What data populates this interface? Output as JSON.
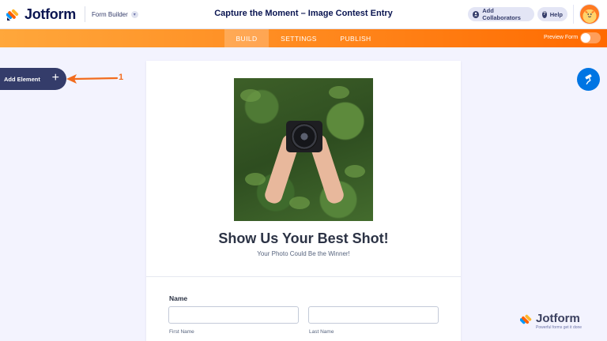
{
  "header": {
    "brand": "Jotform",
    "builder_label": "Form Builder",
    "form_title": "Capture the Moment – Image Contest Entry",
    "add_collaborators": "Add Collaborators",
    "help": "Help"
  },
  "nav": {
    "tabs": [
      {
        "label": "BUILD",
        "active": true
      },
      {
        "label": "SETTINGS",
        "active": false
      },
      {
        "label": "PUBLISH",
        "active": false
      }
    ],
    "preview_label": "Preview Form",
    "preview_on": false
  },
  "sidebar": {
    "add_element_label": "Add Element"
  },
  "annotation": {
    "step_number": "1"
  },
  "form": {
    "heading": "Show Us Your Best Shot!",
    "subheading": "Your Photo Could Be the Winner!",
    "name_field": {
      "label": "Name",
      "first_sublabel": "First Name",
      "last_sublabel": "Last Name",
      "first_value": "",
      "last_value": ""
    }
  },
  "watermark": {
    "brand": "Jotform",
    "tagline": "Powerful forms get it done"
  },
  "colors": {
    "accent_orange": "#ff6a00",
    "navy": "#0a1551",
    "blue": "#0075e3",
    "sidebar_button": "#343c6a"
  },
  "icons": {
    "logo": "jotform-logo-icon",
    "collaborators": "user-icon",
    "help": "question-icon",
    "add": "plus-icon",
    "theme": "paint-roller-icon"
  }
}
